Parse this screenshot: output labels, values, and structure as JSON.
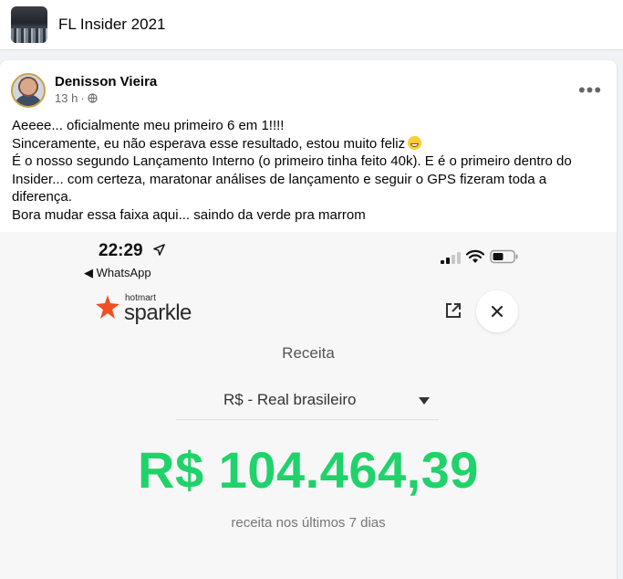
{
  "group": {
    "title": "FL Insider 2021",
    "thumbnail_icon": "group-cover-photo"
  },
  "post": {
    "author_name": "Denisson Vieira",
    "timestamp": "13 h",
    "meta_separator": "·",
    "privacy_icon": "globe-icon",
    "more_icon": "more-options-icon",
    "more_label": "•••",
    "text_lines": [
      "Aeeee... oficialmente meu primeiro 6 em 1!!!!",
      "Sinceramente, eu não esperava esse resultado, estou muito feliz",
      "É o nosso segundo Lançamento Interno (o primeiro tinha feito 40k). E é o primeiro dentro do Insider... com certeza, maratonar análises de lançamento e seguir o GPS fizeram toda a diferença.",
      "Bora mudar essa faixa aqui... saindo da verde pra marrom"
    ],
    "emoji_icon": "grinning-face-emoji"
  },
  "screenshot": {
    "status_bar": {
      "time": "22:29",
      "back_app": "◀ WhatsApp"
    },
    "app": {
      "logo_small": "hotmart",
      "logo_big": "sparkle",
      "close_label": "✕"
    },
    "receita_label": "Receita",
    "currency_value": "R$ - Real brasileiro",
    "revenue_amount": "R$ 104.464,39",
    "revenue_caption": "receita nos últimos 7 dias"
  },
  "colors": {
    "revenue_green": "#1fd36a",
    "hotmart_orange": "#f04e23",
    "facebook_gray": "#65676b"
  }
}
